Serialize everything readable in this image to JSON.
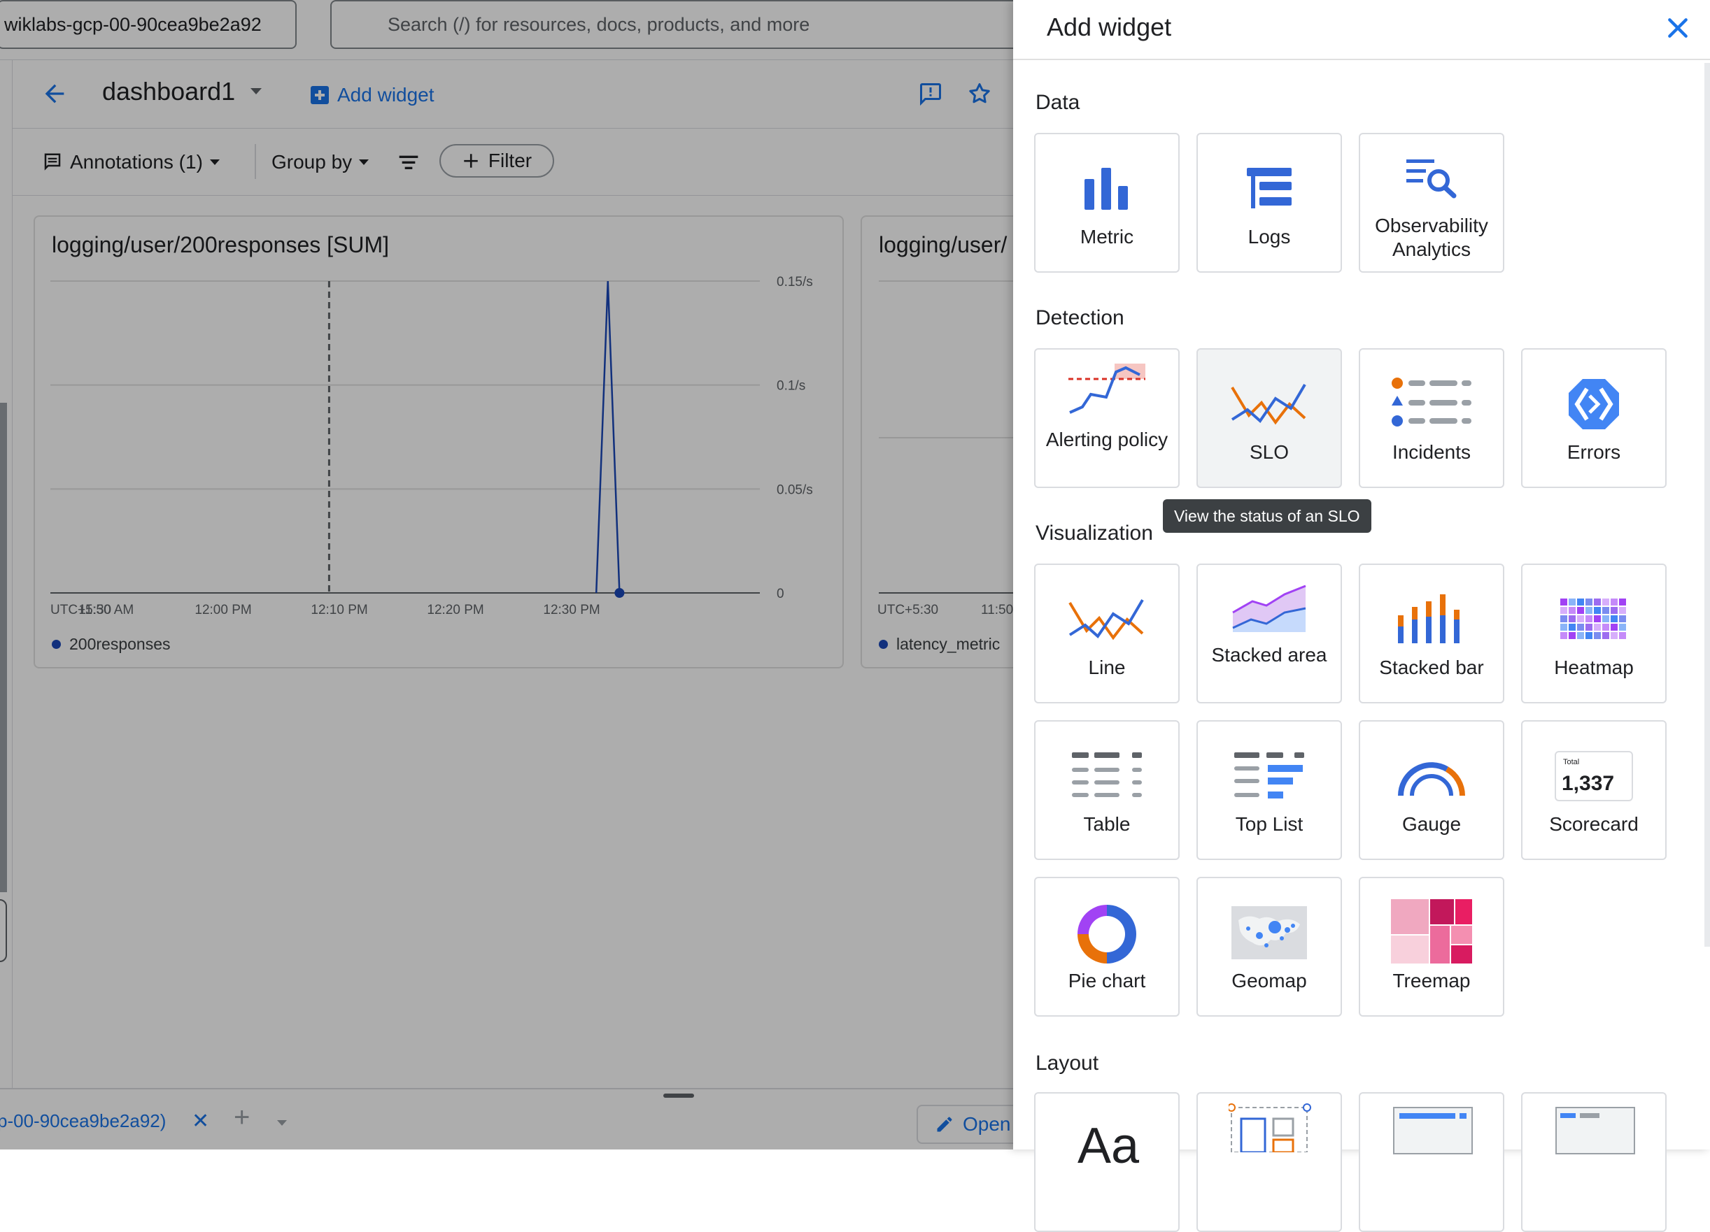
{
  "topbar": {
    "project_label": "wiklabs-gcp-00-90cea9be2a92",
    "search_placeholder": "Search (/) for resources, docs, products, and more"
  },
  "dashboard": {
    "title": "dashboard1",
    "add_widget_label": "Add widget"
  },
  "toolbar": {
    "annotations_label": "Annotations (1)",
    "group_by_label": "Group by",
    "filter_label": "Filter"
  },
  "charts": [
    {
      "title": "logging/user/200responses [SUM]",
      "legend": "200responses"
    },
    {
      "title": "logging/user/",
      "legend": "latency_metric",
      "tick_visible": [
        "UTC+5:30",
        "11:50"
      ]
    }
  ],
  "chart_data": [
    {
      "type": "line",
      "title": "logging/user/200responses [SUM]",
      "x_ticks": [
        "UTC+5:30",
        "11:50 AM",
        "12:00 PM",
        "12:10 PM",
        "12:20 PM",
        "12:30 PM"
      ],
      "y_ticks": [
        "0",
        "0.05/s",
        "0.1/s",
        "0.15/s"
      ],
      "ylim": [
        0,
        0.15
      ],
      "annotation_marker": "12:10 PM",
      "series": [
        {
          "name": "200responses",
          "color": "#1a47b8",
          "points": [
            {
              "x": "12:33 PM",
              "y": 0
            },
            {
              "x": "12:34 PM",
              "y": 0.15
            },
            {
              "x": "12:35 PM",
              "y": 0
            }
          ]
        }
      ]
    }
  ],
  "bottom_bar": {
    "tab_label": "p-00-90cea9be2a92)",
    "open_label": "Open"
  },
  "panel": {
    "title": "Add widget",
    "tooltip": "View the status of an SLO",
    "sections": [
      {
        "title": "Data",
        "tiles": [
          "Metric",
          "Logs",
          "Observability Analytics"
        ]
      },
      {
        "title": "Detection",
        "tiles": [
          "Alerting policy",
          "SLO",
          "Incidents",
          "Errors"
        ]
      },
      {
        "title": "Visualization",
        "tiles": [
          "Line",
          "Stacked area",
          "Stacked bar",
          "Heatmap",
          "Table",
          "Top List",
          "Gauge",
          "Scorecard",
          "Pie chart",
          "Geomap",
          "Treemap"
        ]
      },
      {
        "title": "Layout",
        "tiles": [
          "",
          "",
          "",
          ""
        ]
      }
    ],
    "scorecard_sample": {
      "label": "Total",
      "value": "1,337"
    },
    "text_sample": "Aa"
  },
  "colors": {
    "accent": "#1a73e8",
    "series_blue": "#1a47b8",
    "orange": "#e8710a"
  }
}
